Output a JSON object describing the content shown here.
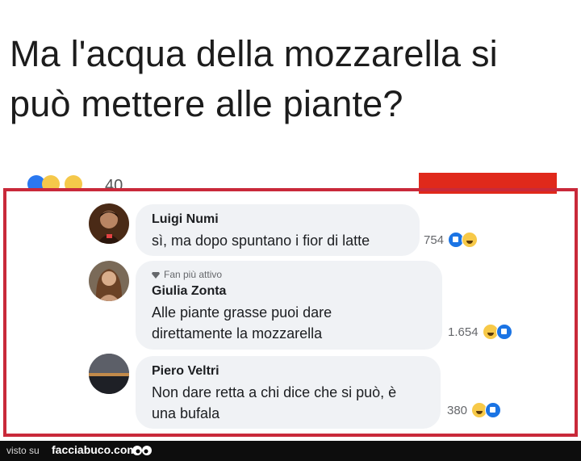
{
  "post": {
    "text_line1": "Ma l'acqua della mozzarella si",
    "text_line2": "può mettere alle piante?",
    "reaction_count_partial": "40"
  },
  "colors": {
    "frame": "#c9293a",
    "red_tab": "#e0291b",
    "bubble": "#f0f2f5",
    "like": "#1b74e4",
    "haha": "#f7c948"
  },
  "comments": [
    {
      "author": "Luigi Numi",
      "lines": [
        "sì, ma dopo spuntano i fior di latte"
      ],
      "reaction_count": "754",
      "reactions": [
        "like-icon",
        "haha-icon"
      ]
    },
    {
      "badge": "Fan più attivo",
      "author": "Giulia Zonta",
      "lines": [
        "Alle piante grasse puoi dare",
        "direttamente la mozzarella"
      ],
      "reaction_count": "1.654",
      "reactions": [
        "haha-icon",
        "like-icon"
      ]
    },
    {
      "author": "Piero Veltri",
      "lines": [
        "Non dare retta a chi dice che si può, è",
        "una bufala"
      ],
      "reaction_count": "380",
      "reactions": [
        "haha-icon",
        "like-icon"
      ]
    }
  ],
  "footer": {
    "visto_su": "visto su",
    "site": "facciabuco.com"
  }
}
